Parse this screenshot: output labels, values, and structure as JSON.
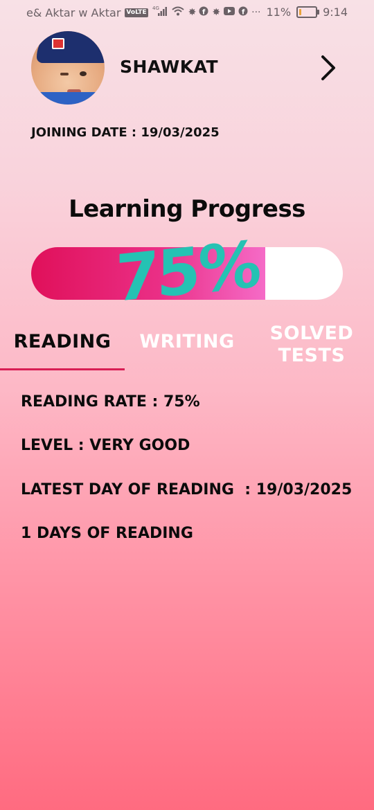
{
  "status_bar": {
    "carrier": "e& Aktar w Aktar",
    "volte": "VoLTE",
    "network": "4G",
    "battery_percent_text": "11%",
    "battery_level": 0.11,
    "time": "9:14",
    "icons": [
      "volte-icon",
      "signal-icon",
      "wifi-icon",
      "notification-icon",
      "facebook-icon",
      "notification-icon",
      "youtube-icon",
      "facebook-icon",
      "more-icon",
      "battery-icon"
    ]
  },
  "profile": {
    "name": "SHAWKAT",
    "joining_date": "JOINING DATE : 19/03/2025"
  },
  "progress": {
    "title": "Learning Progress",
    "percent_text": "75%",
    "value": 0.75,
    "fill_colors": [
      "#e0105a",
      "#f56bc7"
    ],
    "track_color": "#ffffff",
    "percent_color": "#25c2b3"
  },
  "tabs": [
    {
      "label": "READING",
      "active": true
    },
    {
      "label": "WRITING",
      "active": false
    },
    {
      "label": "SOLVED\nTESTS",
      "active": false
    }
  ],
  "reading": {
    "rate": "READING RATE : 75%",
    "level": "LEVEL : VERY GOOD",
    "latest_day": "LATEST DAY OF READING  : 19/03/2025",
    "days": "1 DAYS OF READING"
  },
  "colors": {
    "accent": "#d81e54",
    "teal": "#25c2b3"
  }
}
